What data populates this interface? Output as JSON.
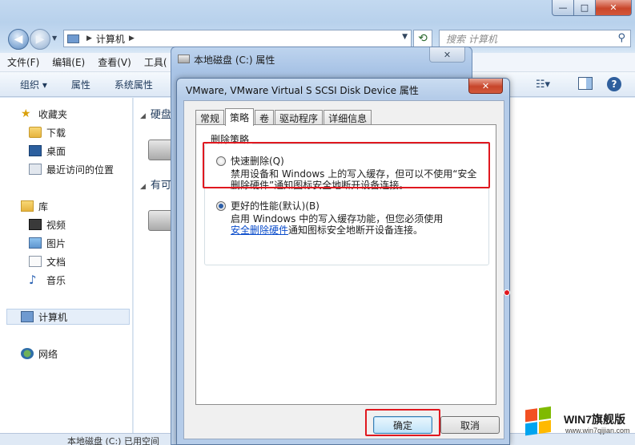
{
  "explorer": {
    "window_controls": {
      "minimize": "—",
      "maximize": "□",
      "close": "✕"
    },
    "address": {
      "root": "计算机"
    },
    "search_placeholder": "搜索 计算机",
    "menu": [
      "文件(F)",
      "编辑(E)",
      "查看(V)",
      "工具("
    ],
    "toolbar": [
      "组织 ▾",
      "属性",
      "系统属性"
    ],
    "sidebar": {
      "favorites": "收藏夹",
      "downloads": "下载",
      "desktop": "桌面",
      "recent": "最近访问的位置",
      "libraries": "库",
      "videos": "视频",
      "pictures": "图片",
      "documents": "文档",
      "music": "音乐",
      "computer": "计算机",
      "network": "网络"
    },
    "content": {
      "group_hdd": "硬盘",
      "group_removable": "有可"
    },
    "status": "本地磁盘 (C:)  已用空间"
  },
  "props_c": {
    "title": "本地磁盘 (C:) 属性",
    "close": "✕"
  },
  "device_dialog": {
    "title": "VMware, VMware Virtual S SCSI Disk Device 属性",
    "close": "✕",
    "tabs": [
      "常规",
      "策略",
      "卷",
      "驱动程序",
      "详细信息"
    ],
    "active_tab": "策略",
    "group_label": "删除策略",
    "quick_removal": {
      "label": "快速删除(Q)",
      "desc_line1": "禁用设备和 Windows 上的写入缓存，但可以不使用“安全",
      "desc_line2": "删除硬件”通知图标安全地断开设备连接。",
      "checked": false
    },
    "better_perf": {
      "label": "更好的性能(默认)(B)",
      "desc_line1": "启用 Windows 中的写入缓存功能，但您必须使用",
      "desc_link": "安全删除硬件",
      "desc_line2": "通知图标安全地断开设备连接。",
      "checked": true
    },
    "ok": "确定",
    "cancel": "取消"
  },
  "watermark": {
    "brand": "WIN7旗舰版",
    "url": "www.win7qijian.com"
  },
  "colors": {
    "highlight": "#e0181f",
    "link": "#0a4ccb"
  }
}
